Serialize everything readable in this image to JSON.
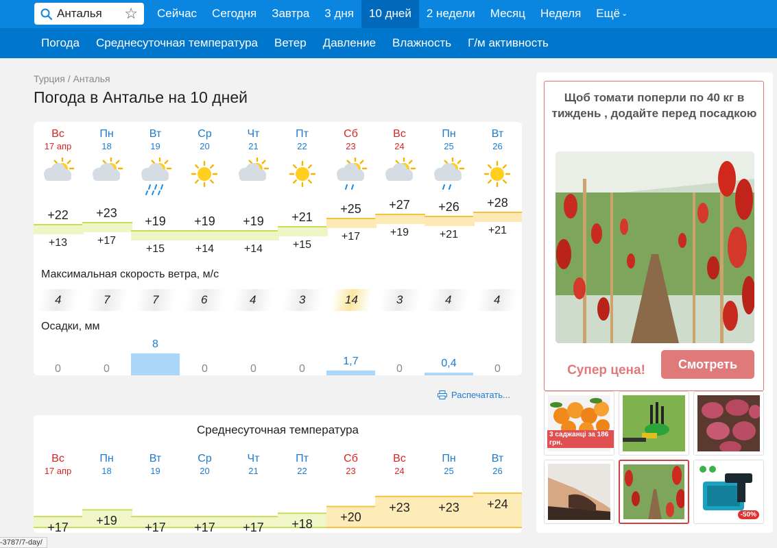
{
  "search": {
    "value": "Анталья"
  },
  "nav": {
    "items": [
      {
        "label": "Сейчас"
      },
      {
        "label": "Сегодня"
      },
      {
        "label": "Завтра"
      },
      {
        "label": "3 дня"
      },
      {
        "label": "10 дней"
      },
      {
        "label": "2 недели"
      },
      {
        "label": "Месяц"
      },
      {
        "label": "Неделя"
      },
      {
        "label": "Ещё"
      }
    ],
    "active": "10 дней"
  },
  "subnav": {
    "items": [
      {
        "label": "Погода"
      },
      {
        "label": "Среднесуточная температура"
      },
      {
        "label": "Ветер"
      },
      {
        "label": "Давление"
      },
      {
        "label": "Влажность"
      },
      {
        "label": "Г/м активность"
      }
    ]
  },
  "breadcrumb": "Турция / Анталья",
  "page_title": "Погода в Анталье на 10 дней",
  "days": [
    {
      "name": "Вс",
      "date": "17 апр",
      "weekend": true,
      "icon": "partly-cloudy-icon",
      "max": "+22",
      "min": "+13",
      "wind": "4",
      "precip": "0",
      "precip_mm": 0
    },
    {
      "name": "Пн",
      "date": "18",
      "weekend": false,
      "icon": "partly-cloudy-icon",
      "max": "+23",
      "min": "+17",
      "wind": "7",
      "precip": "0",
      "precip_mm": 0
    },
    {
      "name": "Вт",
      "date": "19",
      "weekend": false,
      "icon": "rain-icon",
      "max": "+19",
      "min": "+15",
      "wind": "7",
      "precip": "8",
      "precip_mm": 8
    },
    {
      "name": "Ср",
      "date": "20",
      "weekend": false,
      "icon": "sun-icon",
      "max": "+19",
      "min": "+14",
      "wind": "6",
      "precip": "0",
      "precip_mm": 0
    },
    {
      "name": "Чт",
      "date": "21",
      "weekend": false,
      "icon": "partly-cloudy-icon",
      "max": "+19",
      "min": "+14",
      "wind": "4",
      "precip": "0",
      "precip_mm": 0
    },
    {
      "name": "Пт",
      "date": "22",
      "weekend": false,
      "icon": "sun-icon",
      "max": "+21",
      "min": "+15",
      "wind": "3",
      "precip": "0",
      "precip_mm": 0
    },
    {
      "name": "Сб",
      "date": "23",
      "weekend": true,
      "icon": "light-rain-icon",
      "max": "+25",
      "min": "+17",
      "wind": "14",
      "precip": "1,7",
      "precip_mm": 1.7
    },
    {
      "name": "Вс",
      "date": "24",
      "weekend": true,
      "icon": "partly-cloudy-icon",
      "max": "+27",
      "min": "+19",
      "wind": "3",
      "precip": "0",
      "precip_mm": 0
    },
    {
      "name": "Пн",
      "date": "25",
      "weekend": false,
      "icon": "light-rain-icon",
      "max": "+26",
      "min": "+21",
      "wind": "4",
      "precip": "0,4",
      "precip_mm": 0.4
    },
    {
      "name": "Вт",
      "date": "26",
      "weekend": false,
      "icon": "sun-icon",
      "max": "+28",
      "min": "+21",
      "wind": "4",
      "precip": "0",
      "precip_mm": 0
    }
  ],
  "wind_label": "Максимальная скорость ветра, м/с",
  "precip_label": "Осадки, мм",
  "print_label": "Распечатать...",
  "avg_card": {
    "title": "Среднесуточная температура",
    "values": [
      "+17",
      "+19",
      "+17",
      "+17",
      "+17",
      "+18",
      "+20",
      "+23",
      "+23",
      "+24"
    ]
  },
  "chart_data": [
    {
      "type": "line",
      "categories": [
        "17 апр",
        "18",
        "19",
        "20",
        "21",
        "22",
        "23",
        "24",
        "25",
        "26"
      ],
      "series": [
        {
          "values": [
            22,
            23,
            19,
            19,
            19,
            21,
            25,
            27,
            26,
            28
          ]
        },
        {
          "values": [
            13,
            17,
            15,
            14,
            14,
            15,
            17,
            19,
            21,
            21
          ]
        }
      ]
    },
    {
      "type": "bar",
      "categories": [
        "17 апр",
        "18",
        "19",
        "20",
        "21",
        "22",
        "23",
        "24",
        "25",
        "26"
      ],
      "values": [
        0,
        0,
        8,
        0,
        0,
        0,
        1.7,
        0,
        0.4,
        0
      ],
      "ylabel": "Осадки, мм"
    },
    {
      "type": "area",
      "title": "Среднесуточная температура",
      "categories": [
        "17 апр",
        "18",
        "19",
        "20",
        "21",
        "22",
        "23",
        "24",
        "25",
        "26"
      ],
      "values": [
        17,
        19,
        17,
        17,
        17,
        18,
        20,
        23,
        23,
        24
      ]
    }
  ],
  "ad": {
    "headline": "Щоб томати поперли по 40 кг в тиждень , додайте перед посадкою",
    "price": "Супер цена!",
    "button": "Смотреть",
    "thumb1_caption": "3 саджанці за 186 грн.",
    "thumb6_badge": "-50%"
  },
  "status_url": "-3787/7-day/",
  "colors": {
    "accent": "#0a86e0",
    "weekend": "#dd2222",
    "weekday": "#1a7bd0",
    "precip_bar": "#a9d6f9",
    "ad_red": "#e07a7a"
  }
}
